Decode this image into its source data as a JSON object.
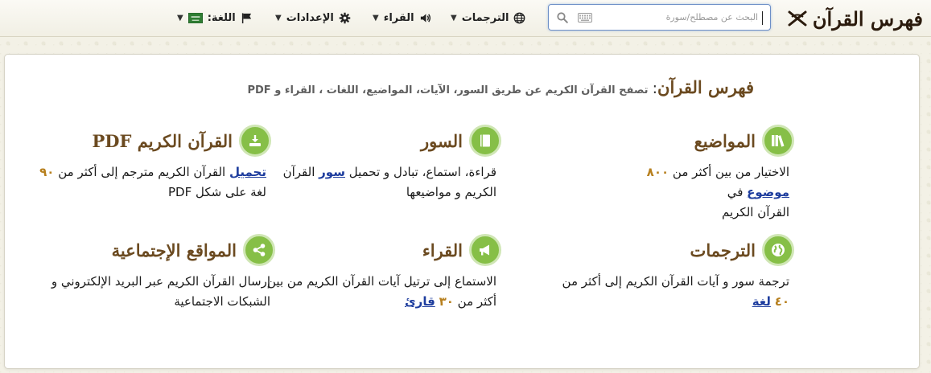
{
  "header": {
    "brand_title": "فهرس القرآن",
    "search": {
      "placeholder": "البحث عن مصطلح/سورة",
      "value": ""
    },
    "menus": [
      {
        "label": "الترجمات"
      },
      {
        "label": "القراء"
      },
      {
        "label": "الإعدادات"
      },
      {
        "label": "اللغة:"
      }
    ]
  },
  "intro": {
    "title": "فهرس القرآن",
    "colon": ":",
    "text": "تصفح القرآن الكريم عن طريق السور، الآيات، المواضيع، اللغات ، القراء و PDF"
  },
  "cards": {
    "topics": {
      "title": "المواضيع",
      "l1a": "الاختيار من بين أكثر من",
      "num": "٨٠٠",
      "link": "موضوع",
      "l1b": "في",
      "l2": "القرآن الكريم"
    },
    "suras": {
      "title": "السور",
      "l1a": "قراءة، استماع، تبادل و تحميل",
      "link": "سور",
      "l1b": "القرآن",
      "l2": "الكريم و مواضيعها"
    },
    "pdf": {
      "title": "القرآن الكريم PDF",
      "link": "تحميل",
      "l1a": "القرآن الكريم مترجم إلى أكثر من",
      "num": "٩٠",
      "l2": "لغة على شكل PDF"
    },
    "translations": {
      "title": "الترجمات",
      "l1": "ترجمة سور و آيات القرآن الكريم إلى أكثر من",
      "num": "٤٠",
      "link": "لغة"
    },
    "reciters": {
      "title": "القراء",
      "l1": "الاستماع إلى ترتيل آيات القرآن الكريم من بين",
      "l2a": "أكثر من",
      "num": "٣٠",
      "link": "قارئ"
    },
    "social": {
      "title": "المواقع الإجتماعية",
      "l1": "إرسال القرآن الكريم عبر البريد الإلكتروني و",
      "l2": "الشبكات الاجتماعية"
    }
  },
  "colors": {
    "accent_green": "#86bf47",
    "title_brown": "#6b4a20",
    "number_gold": "#b7801f",
    "link_blue": "#1e3d9e"
  }
}
